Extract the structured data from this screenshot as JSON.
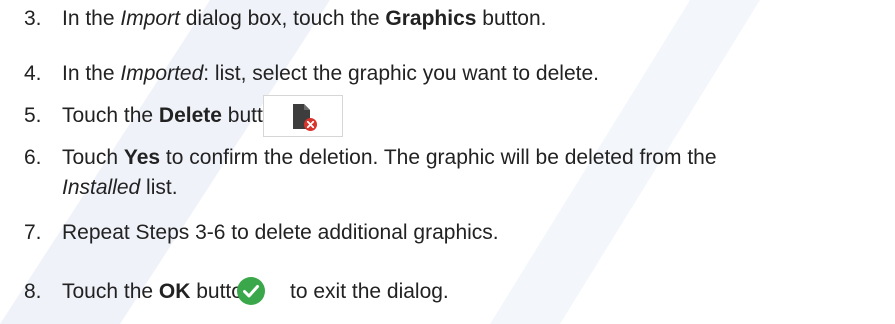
{
  "steps": [
    {
      "number": "3.",
      "pre": "In the ",
      "italic": "Import",
      "mid": " dialog box, touch the ",
      "bold": "Graphics",
      "post": " button."
    },
    {
      "number": "4.",
      "pre": "In the ",
      "italic": "Imported",
      "post": ": list, select the graphic you want to delete."
    },
    {
      "number": "5.",
      "pre": "Touch the ",
      "bold": "Delete",
      "post": " button.",
      "icon": "delete-graphic-icon"
    },
    {
      "number": "6.",
      "pre": "Touch ",
      "bold": "Yes",
      "post": " to confirm the deletion. The graphic will be deleted from the",
      "line2_italic": "Installed",
      "line2_post": " list."
    },
    {
      "number": "7.",
      "text": "Repeat Steps 3-6 to delete additional graphics."
    },
    {
      "number": "8.",
      "pre": "Touch the ",
      "bold": "OK",
      "post": " button",
      "icon": "ok-check-icon",
      "post2": "to exit the dialog."
    }
  ],
  "colors": {
    "text": "#222222",
    "ok_green": "#3aa84a",
    "delete_red": "#d9342b",
    "icon_dark": "#3d3d3d",
    "watermark": "#dfe6f3"
  }
}
